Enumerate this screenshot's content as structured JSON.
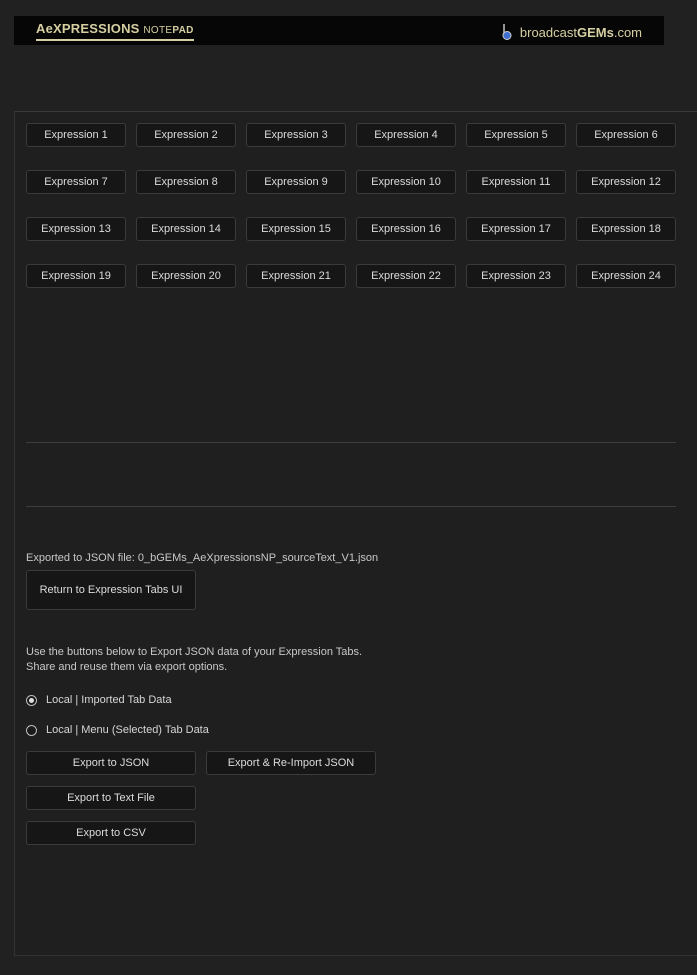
{
  "header": {
    "title_main": "AeXPRESSIONS",
    "title_sub_light": "NOTE",
    "title_sub_bold": "PAD",
    "brand_prefix": "broadcast",
    "brand_bold": "GEMs",
    "brand_suffix": ".com",
    "logo_icon": "music-note-icon"
  },
  "expression_tabs": [
    "Expression 1",
    "Expression 2",
    "Expression 3",
    "Expression 4",
    "Expression 5",
    "Expression 6",
    "Expression 7",
    "Expression 8",
    "Expression 9",
    "Expression 10",
    "Expression 11",
    "Expression 12",
    "Expression 13",
    "Expression 14",
    "Expression 15",
    "Expression 16",
    "Expression 17",
    "Expression 18",
    "Expression 19",
    "Expression 20",
    "Expression 21",
    "Expression 22",
    "Expression 23",
    "Expression 24"
  ],
  "export": {
    "status": "Exported to JSON file: 0_bGEMs_AeXpressionsNP_sourceText_V1.json",
    "return_label": "Return to Expression Tabs UI",
    "info_line1": "Use the buttons below to Export JSON data of your Expression Tabs.",
    "info_line2": "Share and reuse them via export options.",
    "option_local_imported": "Local | Imported Tab Data",
    "option_local_menu": "Local | Menu (Selected) Tab Data",
    "selected_option": "local_imported",
    "btn_export_json": "Export to JSON",
    "btn_export_reimport": "Export & Re-Import JSON",
    "btn_export_text": "Export to Text File",
    "btn_export_csv": "Export to CSV"
  },
  "colors": {
    "accent_gold": "#d6cfa2",
    "background": "#212121",
    "button_bg": "#161616"
  }
}
